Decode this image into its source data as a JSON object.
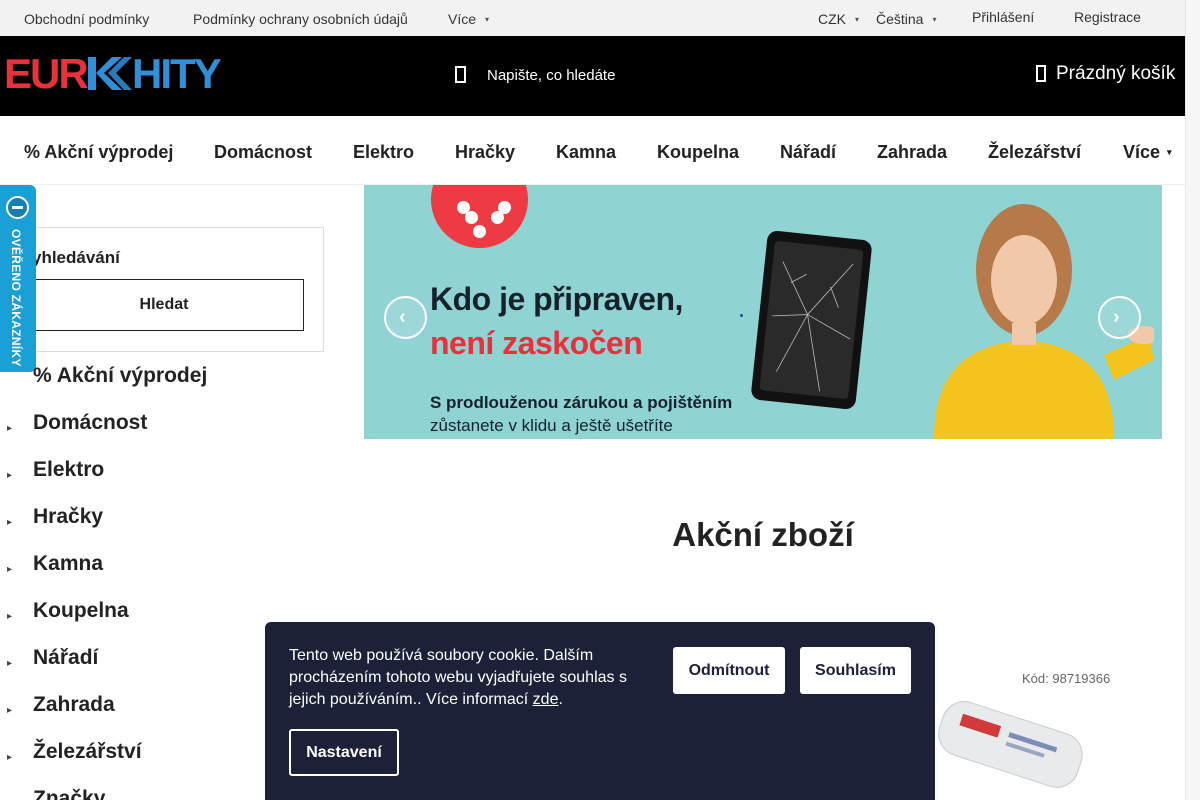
{
  "topbar": {
    "links": [
      "Obchodní podmínky",
      "Podmínky ochrany osobních údajů",
      "Více"
    ],
    "currency": "CZK",
    "language": "Čeština",
    "login": "Přihlášení",
    "register": "Registrace"
  },
  "header": {
    "logo_text": "EUROHITY",
    "search_placeholder": "Napište, co hledáte",
    "cart_label": "Prázdný košík"
  },
  "mainnav": {
    "items": [
      "% Akční výprodej",
      "Domácnost",
      "Elektro",
      "Hračky",
      "Kamna",
      "Koupelna",
      "Nářadí",
      "Zahrada",
      "Železářství",
      "Více"
    ]
  },
  "badge": {
    "text": "OVĚŘENO ZÁKAZNÍKY"
  },
  "sidebar": {
    "search_label": "yhledávání",
    "search_button": "Hledat",
    "categories": [
      "% Akční výprodej",
      "Domácnost",
      "Elektro",
      "Hračky",
      "Kamna",
      "Koupelna",
      "Nářadí",
      "Zahrada",
      "Železářství",
      "Značky"
    ]
  },
  "banner": {
    "headline_1": "Kdo je připraven,",
    "headline_2": "není zaskočen",
    "subline_1": "S prodlouženou zárukou a pojištěním",
    "subline_2": "zůstanete v klidu a ještě ušetříte",
    "accent_color": "#e8313b",
    "bg_color": "#8fd3d3"
  },
  "content": {
    "section_title": "Akční zboží",
    "product_code": "Kód: 98719366"
  },
  "cookie": {
    "text": "Tento web používá soubory cookie. Dalším procházením tohoto webu vyjadřujete souhlas s jejich používáním.. Více informací",
    "link": "zde",
    "text_end": ".",
    "reject": "Odmítnout",
    "accept": "Souhlasím",
    "settings": "Nastavení"
  }
}
